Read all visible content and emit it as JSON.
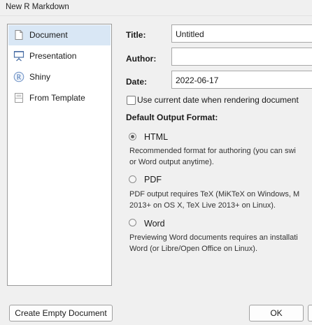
{
  "window": {
    "title": "New R Markdown"
  },
  "sidebar": {
    "items": [
      {
        "label": "Document",
        "icon": "document-icon",
        "selected": true
      },
      {
        "label": "Presentation",
        "icon": "presentation-icon",
        "selected": false
      },
      {
        "label": "Shiny",
        "icon": "shiny-r-icon",
        "selected": false
      },
      {
        "label": "From Template",
        "icon": "template-icon",
        "selected": false
      }
    ]
  },
  "form": {
    "title_label": "Title:",
    "title_value": "Untitled",
    "author_label": "Author:",
    "author_value": "",
    "date_label": "Date:",
    "date_value": "2022-06-17",
    "use_current_date_label": "Use current date when rendering document",
    "use_current_date_checked": false
  },
  "output_format": {
    "heading": "Default Output Format:",
    "options": [
      {
        "label": "HTML",
        "selected": true,
        "description_line1": "Recommended format for authoring (you can swi",
        "description_line2": "or Word output anytime)."
      },
      {
        "label": "PDF",
        "selected": false,
        "description_line1": "PDF output requires TeX (MiKTeX on Windows, M",
        "description_line2": "2013+ on OS X, TeX Live 2013+ on Linux)."
      },
      {
        "label": "Word",
        "selected": false,
        "description_line1": "Previewing Word documents requires an installati",
        "description_line2": "Word (or Libre/Open Office on Linux)."
      }
    ]
  },
  "buttons": {
    "create_empty": "Create Empty Document",
    "ok": "OK"
  },
  "colors": {
    "selected_bg": "#d9e7f5",
    "window_bg": "#f0f0f0"
  }
}
